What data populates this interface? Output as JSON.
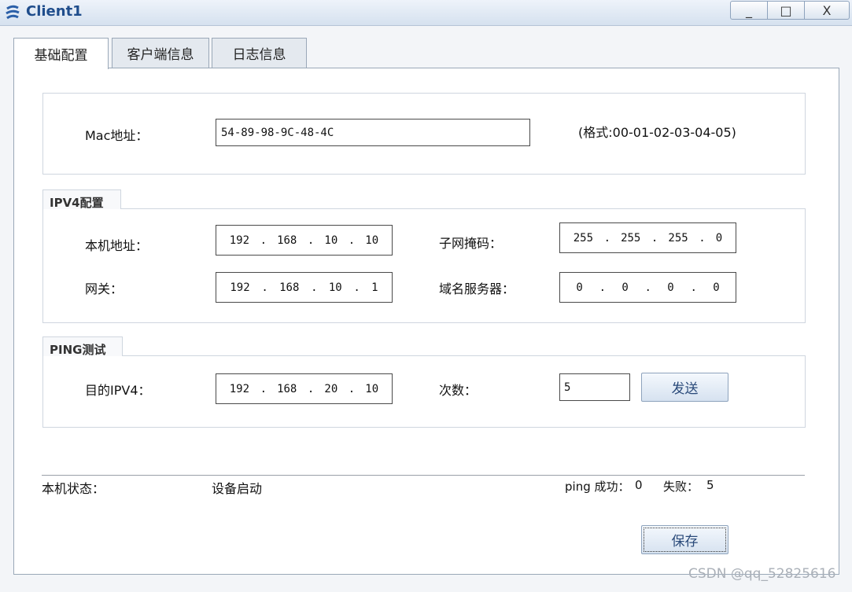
{
  "window": {
    "title": "Client1",
    "minimize": "_",
    "maximize": "□",
    "close": "X"
  },
  "tabs": [
    {
      "label": "基础配置"
    },
    {
      "label": "客户端信息"
    },
    {
      "label": "日志信息"
    }
  ],
  "mac": {
    "label": "Mac地址：",
    "value": "54-89-98-9C-48-4C",
    "hint": "(格式:00-01-02-03-04-05)"
  },
  "ipv4": {
    "group_title": "IPV4配置",
    "local_label": "本机地址：",
    "local": [
      "192",
      "168",
      "10",
      "10"
    ],
    "mask_label": "子网掩码：",
    "mask": [
      "255",
      "255",
      "255",
      "0"
    ],
    "gateway_label": "网关：",
    "gateway": [
      "192",
      "168",
      "10",
      "1"
    ],
    "dns_label": "域名服务器：",
    "dns": [
      "0",
      "0",
      "0",
      "0"
    ]
  },
  "ping": {
    "group_title": "PING测试",
    "dest_label": "目的IPV4：",
    "dest": [
      "192",
      "168",
      "20",
      "10"
    ],
    "count_label": "次数：",
    "count": "5",
    "send_button": "发送"
  },
  "status": {
    "label": "本机状态：",
    "value": "设备启动",
    "ping_success_label": "ping 成功：",
    "ping_success": "0",
    "ping_fail_label": "失败：",
    "ping_fail": "5"
  },
  "save_button": "保存",
  "watermark": "CSDN @qq_52825616"
}
